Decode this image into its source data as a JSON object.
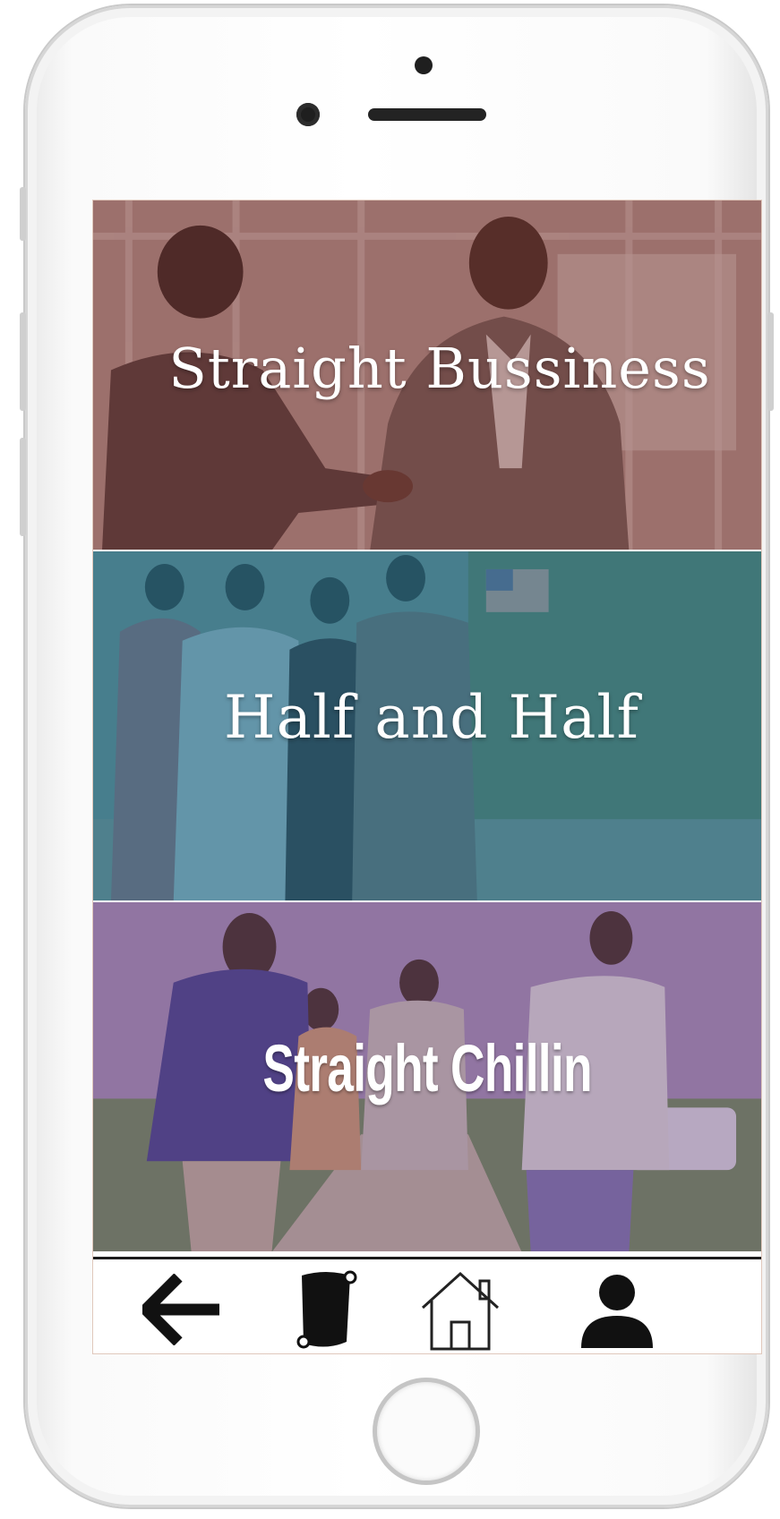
{
  "screen": {
    "categories": [
      {
        "label": "Straight Bussiness",
        "tint": "#7a3f3f"
      },
      {
        "label": "Half and Half",
        "tint": "#2f6f82"
      },
      {
        "label": "Straight Chillin",
        "tint": "#6d4d7e"
      }
    ]
  },
  "bottom_nav": {
    "items": [
      {
        "icon": "back-arrow-icon"
      },
      {
        "icon": "scroll-icon"
      },
      {
        "icon": "home-icon"
      },
      {
        "icon": "profile-icon"
      }
    ]
  }
}
